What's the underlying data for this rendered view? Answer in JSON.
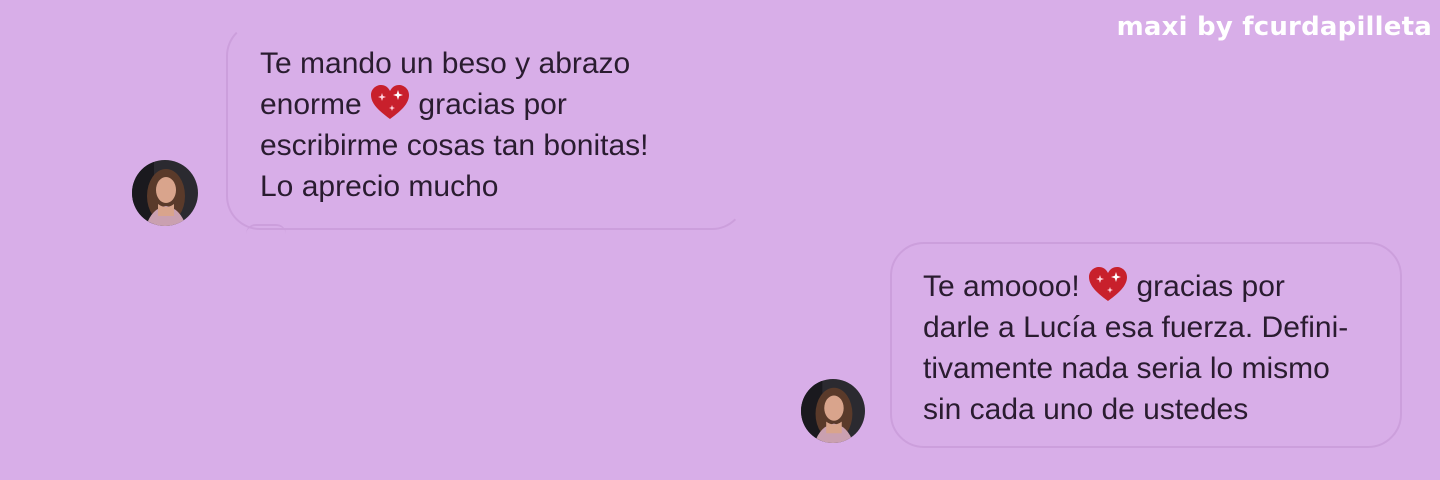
{
  "watermark": "maxi by fcurdapilleta",
  "messages": [
    {
      "lines": [
        "Te mando un beso y abrazo",
        "enorme",
        "gracias por",
        "escribirme cosas tan bonitas!",
        "Lo aprecio mucho"
      ],
      "emoji": "sparkling-heart-icon"
    },
    {
      "lines": [
        "Te amoooo!",
        "gracias por",
        "darle a Lucía esa fuerza. Defini-",
        "tivamente nada seria lo mismo",
        "sin cada uno de ustedes"
      ],
      "emoji": "sparkling-heart-icon"
    }
  ],
  "colors": {
    "background": "#d8aee8",
    "bubble_border": "#cc9fdc",
    "text": "#2a1c30",
    "heart": "#c8202c",
    "watermark": "#ffffff"
  }
}
